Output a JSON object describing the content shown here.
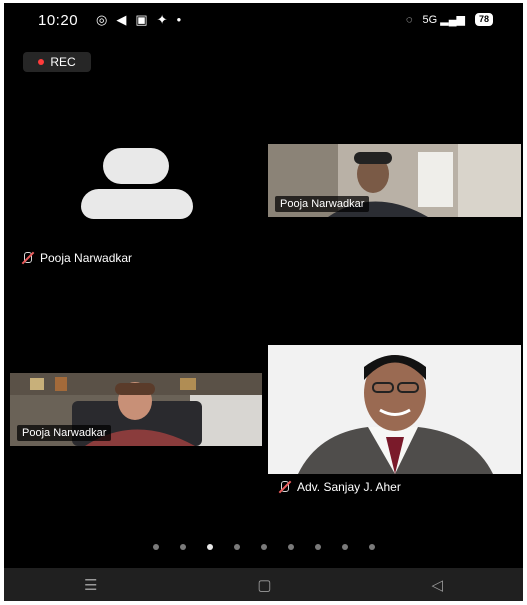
{
  "status_bar": {
    "time": "10:20",
    "signal_text": "5G",
    "battery": "78"
  },
  "recording": {
    "label": "REC"
  },
  "participants": [
    {
      "name": "Pooja Narwadkar",
      "video": false,
      "muted": true
    },
    {
      "name": "Pooja Narwadkar",
      "video": true
    },
    {
      "name": "Pooja Narwadkar",
      "video": true
    },
    {
      "name": "Adv. Sanjay J. Aher",
      "video": true,
      "muted": true
    }
  ],
  "pagination": {
    "count": 9,
    "active_index": 2
  },
  "nav": {
    "menu_icon": "menu-icon",
    "home_icon": "home-icon",
    "back_icon": "back-icon"
  },
  "colors": {
    "background": "#000000",
    "rec_dot": "#ff3b3b",
    "muted_slash": "#e85b5b"
  }
}
